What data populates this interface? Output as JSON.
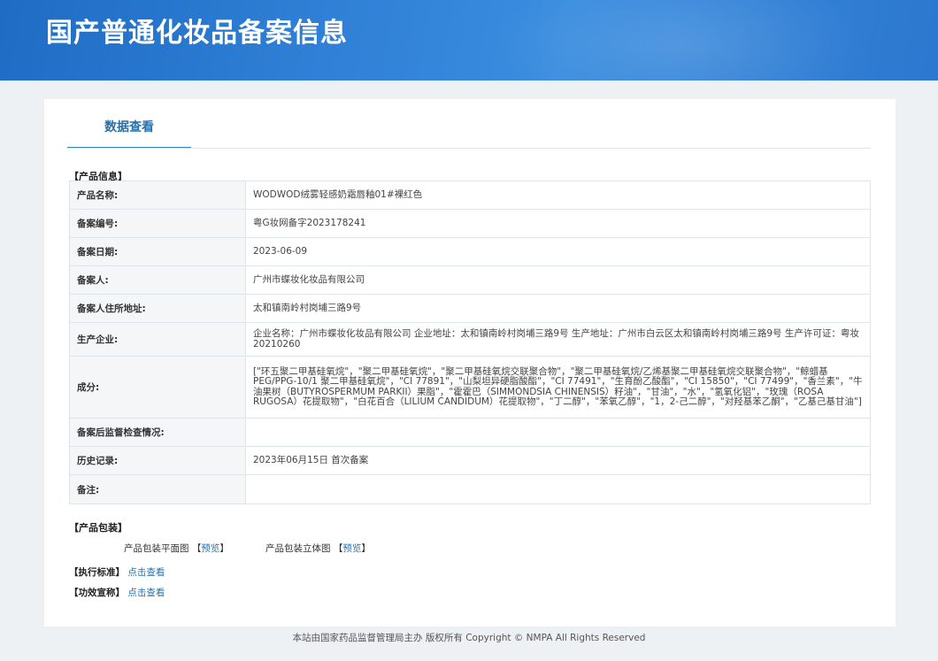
{
  "banner": {
    "title": "国产普通化妆品备案信息"
  },
  "tab": {
    "label": "数据查看"
  },
  "product_info": {
    "section_label": "【产品信息】",
    "rows": [
      {
        "key": "产品名称:",
        "value": "WODWOD绒雾轻感奶霜唇釉01#裸红色"
      },
      {
        "key": "备案编号:",
        "value": "粤G妆网备字2023178241"
      },
      {
        "key": "备案日期:",
        "value": "2023-06-09"
      },
      {
        "key": "备案人:",
        "value": "广州市蝶妆化妆品有限公司"
      },
      {
        "key": "备案人住所地址:",
        "value": "太和镇南岭村岗埔三路9号"
      },
      {
        "key": "生产企业:",
        "value": "企业名称：广州市蝶妆化妆品有限公司 企业地址：太和镇南岭村岗埔三路9号 生产地址：广州市白云区太和镇南岭村岗埔三路9号 生产许可证：粤妆20210260"
      },
      {
        "key": "成分:",
        "value": "[\"环五聚二甲基硅氧烷\"，\"聚二甲基硅氧烷\"，\"聚二甲基硅氧烷交联聚合物\"，\"聚二甲基硅氧烷/乙烯基聚二甲基硅氧烷交联聚合物\"，\"鲸蜡基 PEG/PPG-10/1 聚二甲基硅氧烷\"，\"CI 77891\"，\"山梨坦异硬脂酸酯\"，\"CI 77491\"，\"生育酚乙酸酯\"，\"CI 15850\"，\"CI 77499\"，\"香兰素\"，\"牛油果树（BUTYROSPERMUM PARKII）果脂\"，\"霍霍巴（SIMMONDSIA CHINENSIS）籽油\"，\"甘油\"，\"水\"，\"氢氧化铝\"，\"玫瑰（ROSA RUGOSA）花提取物\"，\"白花百合（LILIUM CANDIDUM）花提取物\"，\"丁二醇\"，\"苯氧乙醇\"，\"1，2-己二醇\"，\"对羟基苯乙酮\"，\"乙基己基甘油\"]"
      },
      {
        "key": "备案后监督检查情况:",
        "value": ""
      },
      {
        "key": "历史记录:",
        "value": "2023年06月15日 首次备案"
      },
      {
        "key": "备注:",
        "value": ""
      }
    ]
  },
  "packaging": {
    "section_label": "【产品包装】",
    "flat_label": "产品包装平面图",
    "flat_link": "预览",
    "solid_label": "产品包装立体图",
    "solid_link": "预览",
    "bracket_open": "【",
    "bracket_close": "】"
  },
  "standard": {
    "label": "【执行标准】",
    "link": "点击查看"
  },
  "efficacy": {
    "label": "【功效宣称】",
    "link": "点击查看"
  },
  "footer": {
    "text": "本站由国家药品监督管理局主办 版权所有 Copyright © NMPA All Rights Reserved"
  }
}
